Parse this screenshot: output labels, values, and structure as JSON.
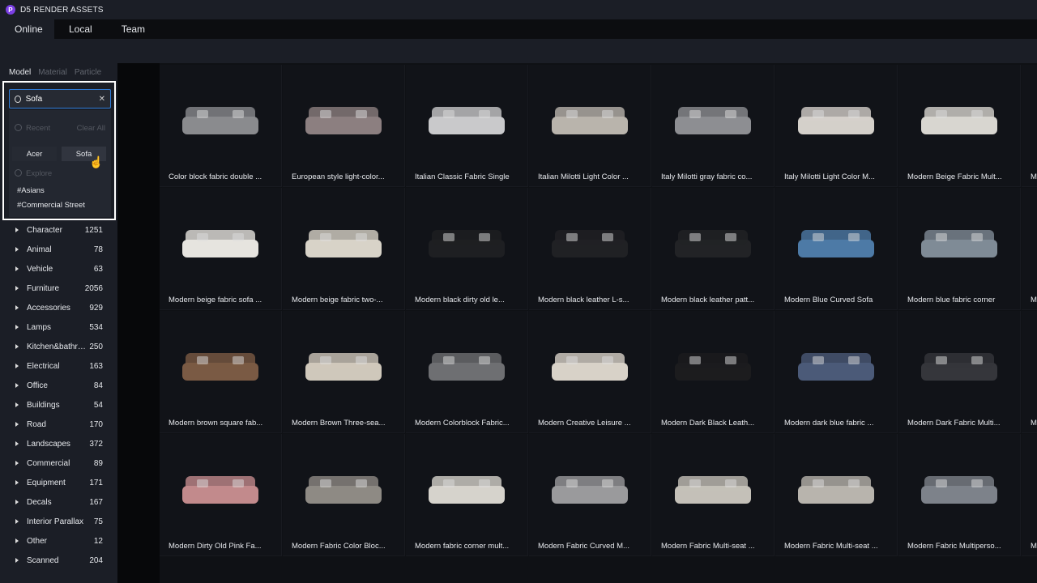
{
  "app": {
    "title": "D5 RENDER ASSETS",
    "logo_letter": "P"
  },
  "tabs": [
    {
      "label": "Online",
      "active": true
    },
    {
      "label": "Local"
    },
    {
      "label": "Team"
    }
  ],
  "asset_types": [
    {
      "label": "Model",
      "active": true
    },
    {
      "label": "Material"
    },
    {
      "label": "Particle"
    }
  ],
  "search": {
    "value": "Sofa",
    "recent_label": "Recent",
    "clear_all": "Clear All",
    "recent": [
      "Acer",
      "Sofa"
    ],
    "explore_label": "Explore",
    "explore_tags": [
      "#Asians",
      "#Commercial Street"
    ]
  },
  "categories": [
    {
      "name": "Character",
      "count": "1251"
    },
    {
      "name": "Animal",
      "count": "78"
    },
    {
      "name": "Vehicle",
      "count": "63"
    },
    {
      "name": "Furniture",
      "count": "2056"
    },
    {
      "name": "Accessories",
      "count": "929"
    },
    {
      "name": "Lamps",
      "count": "534"
    },
    {
      "name": "Kitchen&bathroom",
      "count": "250"
    },
    {
      "name": "Electrical",
      "count": "163"
    },
    {
      "name": "Office",
      "count": "84"
    },
    {
      "name": "Buildings",
      "count": "54"
    },
    {
      "name": "Road",
      "count": "170"
    },
    {
      "name": "Landscapes",
      "count": "372"
    },
    {
      "name": "Commercial",
      "count": "89"
    },
    {
      "name": "Equipment",
      "count": "171"
    },
    {
      "name": "Decals",
      "count": "167"
    },
    {
      "name": "Interior Parallax",
      "count": "75"
    },
    {
      "name": "Other",
      "count": "12"
    },
    {
      "name": "Scanned",
      "count": "204"
    }
  ],
  "assets": [
    {
      "label": "Color block fabric double ...",
      "color": "#8a8b8e"
    },
    {
      "label": "European style light-color...",
      "color": "#8c7f80"
    },
    {
      "label": "Italian Classic Fabric Single",
      "color": "#c9c9cb"
    },
    {
      "label": "Italian Milotti Light Color ...",
      "color": "#b9b4ac"
    },
    {
      "label": "Italy Milotti gray fabric co...",
      "color": "#8d8e92"
    },
    {
      "label": "Italy Milotti Light Color M...",
      "color": "#d4d0ca"
    },
    {
      "label": "Modern Beige Fabric Mult...",
      "color": "#d8d6d0"
    },
    {
      "label": "M",
      "color": "#555"
    },
    {
      "label": "Modern beige fabric sofa ...",
      "color": "#e6e4df"
    },
    {
      "label": "Modern beige fabric two-...",
      "color": "#d8d3c8"
    },
    {
      "label": "Modern black dirty old le...",
      "color": "#1e1f22"
    },
    {
      "label": "Modern black leather L-s...",
      "color": "#202124"
    },
    {
      "label": "Modern black leather patt...",
      "color": "#222326"
    },
    {
      "label": "Modern Blue Curved Sofa",
      "color": "#4d7aa6"
    },
    {
      "label": "Modern blue fabric corner",
      "color": "#7f8b96"
    },
    {
      "label": "M",
      "color": "#555"
    },
    {
      "label": "Modern brown square fab...",
      "color": "#7a5a44"
    },
    {
      "label": "Modern Brown Three-sea...",
      "color": "#cfc8bb"
    },
    {
      "label": "Modern Colorblock Fabric...",
      "color": "#6e6f72"
    },
    {
      "label": "Modern Creative Leisure ...",
      "color": "#d8d2c8"
    },
    {
      "label": "Modern Dark Black Leath...",
      "color": "#1c1c1e"
    },
    {
      "label": "Modern dark blue fabric ...",
      "color": "#4b5a78"
    },
    {
      "label": "Modern Dark Fabric Multi...",
      "color": "#35363b"
    },
    {
      "label": "M",
      "color": "#555"
    },
    {
      "label": "Modern Dirty Old Pink Fa...",
      "color": "#c28a8c"
    },
    {
      "label": "Modern Fabric Color Bloc...",
      "color": "#8e8a84"
    },
    {
      "label": "Modern fabric corner mult...",
      "color": "#d6d3cc"
    },
    {
      "label": "Modern Fabric Curved M...",
      "color": "#9a9a9c"
    },
    {
      "label": "Modern Fabric Multi-seat ...",
      "color": "#c4c0b8"
    },
    {
      "label": "Modern Fabric Multi-seat ...",
      "color": "#b8b4ad"
    },
    {
      "label": "Modern Fabric Multiperso...",
      "color": "#7d828a"
    },
    {
      "label": "M",
      "color": "#555"
    }
  ]
}
